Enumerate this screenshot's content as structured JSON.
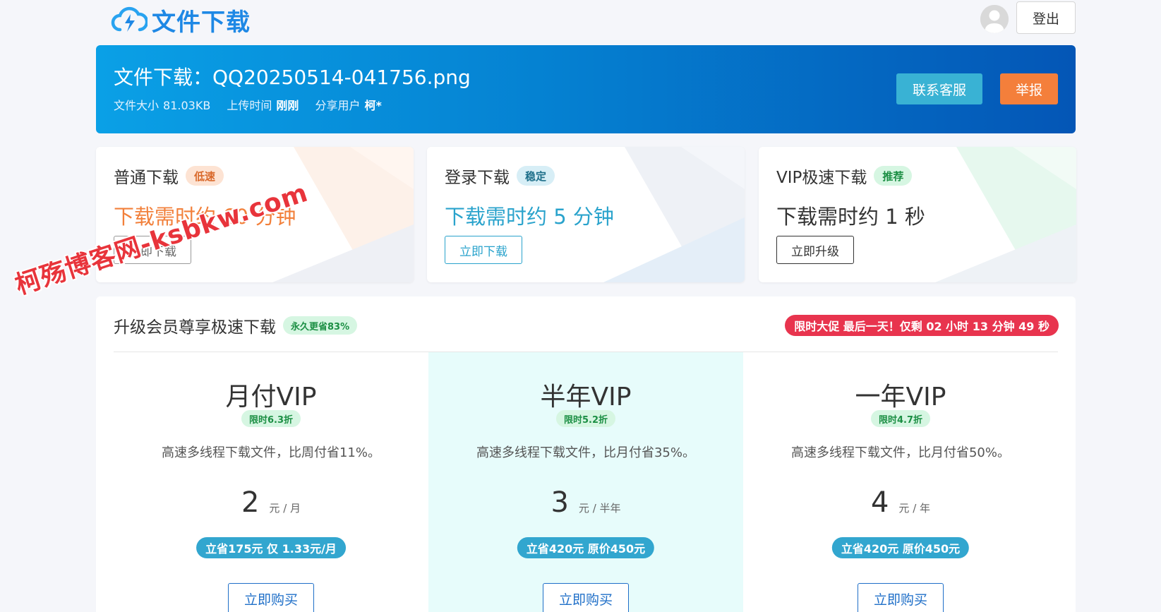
{
  "brand": {
    "name": "文件下载",
    "logo_icon": "cloud-lightning-icon",
    "color": "#1e88e5"
  },
  "header": {
    "avatar_icon": "user-avatar-icon",
    "logout_label": "登出"
  },
  "file": {
    "title": "文件下载：QQ20250514-041756.png",
    "size_key": "文件大小",
    "size_value": "81.03KB",
    "upload_key": "上传时间",
    "upload_value": "刚刚",
    "sharer_key": "分享用户",
    "sharer_value": "柯*"
  },
  "banner_actions": {
    "service_label": "联系客服",
    "report_label": "举报"
  },
  "download_options": [
    {
      "title": "普通下载",
      "badge": "低速",
      "time": "下载需时约 60 分钟",
      "button": "立即下载",
      "accent": "#f2803b"
    },
    {
      "title": "登录下载",
      "badge": "稳定",
      "time": "下载需时约 5 分钟",
      "button": "立即下载",
      "accent": "#2aa3cc"
    },
    {
      "title": "VIP极速下载",
      "badge": "推荐",
      "time": "下载需时约 1 秒",
      "button": "立即升级",
      "accent": "#333333"
    }
  ],
  "watermark": "柯殇博客网-ksbkw.com",
  "vip": {
    "title": "升级会员尊享极速下载",
    "badge": "永久更省83%",
    "promo": "限时大促 最后一天！仅剩 02 小时 13 分钟 49 秒",
    "plans": [
      {
        "name": "月付VIP",
        "badge": "限时6.3折",
        "desc": "高速多线程下载文件，比周付省11%。",
        "price": "2",
        "unit": "元 / 月",
        "save": "立省175元 仅 1.33元/月",
        "buy": "立即购买"
      },
      {
        "name": "半年VIP",
        "badge": "限时5.2折",
        "desc": "高速多线程下载文件，比月付省35%。",
        "price": "3",
        "unit": "元 / 半年",
        "save": "立省420元 原价450元",
        "buy": "立即购买"
      },
      {
        "name": "一年VIP",
        "badge": "限时4.7折",
        "desc": "高速多线程下载文件，比月付省50%。",
        "price": "4",
        "unit": "元 / 年",
        "save": "立省420元 原价450元",
        "buy": "立即购买"
      }
    ]
  }
}
